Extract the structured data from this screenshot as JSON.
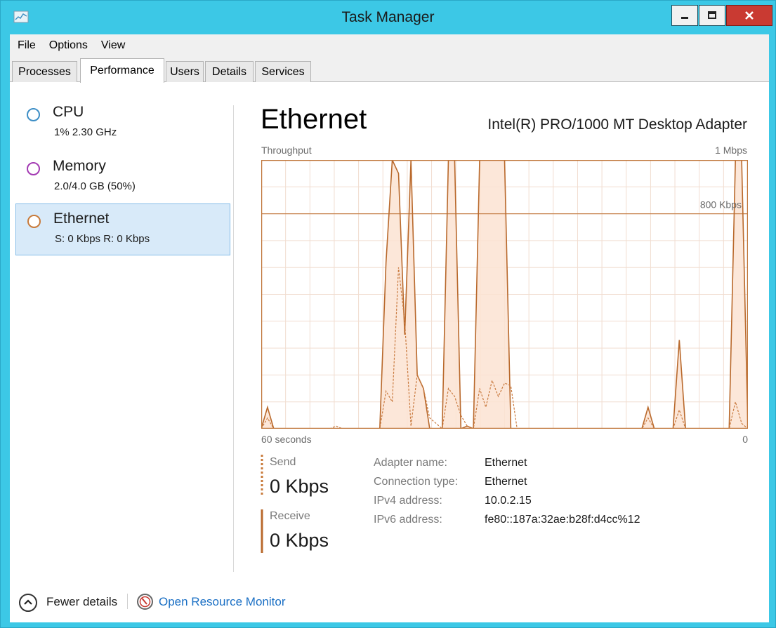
{
  "window": {
    "title": "Task Manager"
  },
  "menu": [
    "File",
    "Options",
    "View"
  ],
  "tabs": [
    "Processes",
    "Performance",
    "Users",
    "Details",
    "Services"
  ],
  "active_tab": "Performance",
  "sidebar": {
    "items": [
      {
        "title": "CPU",
        "sub": "1% 2.30 GHz",
        "color": "#3d8ec6"
      },
      {
        "title": "Memory",
        "sub": "2.0/4.0 GB (50%)",
        "color": "#a33ab3"
      },
      {
        "title": "Ethernet",
        "sub": "S: 0 Kbps R: 0 Kbps",
        "color": "#c87a3a",
        "selected": true
      }
    ]
  },
  "main": {
    "heading": "Ethernet",
    "adapter": "Intel(R) PRO/1000 MT Desktop Adapter",
    "graph_label": "Throughput",
    "graph_max": "1 Mbps",
    "graph_mark": "800 Kbps",
    "time_start": "60 seconds",
    "time_end": "0"
  },
  "stats": {
    "send_label": "Send",
    "send_value": "0 Kbps",
    "receive_label": "Receive",
    "receive_value": "0 Kbps"
  },
  "properties": [
    {
      "key": "Adapter name:",
      "value": "Ethernet"
    },
    {
      "key": "Connection type:",
      "value": "Ethernet"
    },
    {
      "key": "IPv4 address:",
      "value": "10.0.2.15"
    },
    {
      "key": "IPv6 address:",
      "value": "fe80::187a:32ae:b28f:d4cc%12"
    }
  ],
  "footer": {
    "fewer_details": "Fewer details",
    "resource_monitor": "Open Resource Monitor"
  },
  "chart_data": {
    "type": "area",
    "x_range_seconds": [
      60,
      0
    ],
    "y_unit": "Kbps",
    "ylim": [
      0,
      1000
    ],
    "grid": true,
    "series": [
      {
        "name": "Receive",
        "line_style": "solid",
        "values": [
          0,
          80,
          0,
          0,
          0,
          0,
          0,
          0,
          0,
          0,
          0,
          0,
          0,
          0,
          0,
          0,
          0,
          0,
          0,
          0,
          620,
          1000,
          950,
          350,
          1000,
          200,
          150,
          0,
          0,
          0,
          1000,
          1000,
          0,
          10,
          0,
          1000,
          1000,
          1000,
          1000,
          1000,
          0,
          0,
          0,
          0,
          0,
          0,
          0,
          0,
          0,
          0,
          0,
          0,
          0,
          0,
          0,
          0,
          0,
          0,
          0,
          0,
          0,
          0,
          80,
          0,
          0,
          0,
          0,
          330,
          0,
          0,
          0,
          0,
          0,
          0,
          0,
          0,
          1000,
          1000,
          0
        ]
      },
      {
        "name": "Send",
        "line_style": "dashed",
        "values": [
          0,
          40,
          0,
          0,
          0,
          0,
          0,
          0,
          0,
          0,
          0,
          0,
          10,
          0,
          0,
          0,
          0,
          0,
          0,
          0,
          140,
          100,
          600,
          400,
          10,
          200,
          150,
          40,
          20,
          0,
          150,
          120,
          50,
          10,
          0,
          150,
          80,
          180,
          120,
          170,
          160,
          0,
          0,
          0,
          0,
          0,
          0,
          0,
          0,
          0,
          0,
          0,
          0,
          0,
          0,
          0,
          0,
          0,
          0,
          0,
          0,
          0,
          40,
          0,
          0,
          0,
          0,
          70,
          0,
          0,
          0,
          0,
          0,
          0,
          0,
          0,
          100,
          20,
          0
        ]
      }
    ]
  }
}
